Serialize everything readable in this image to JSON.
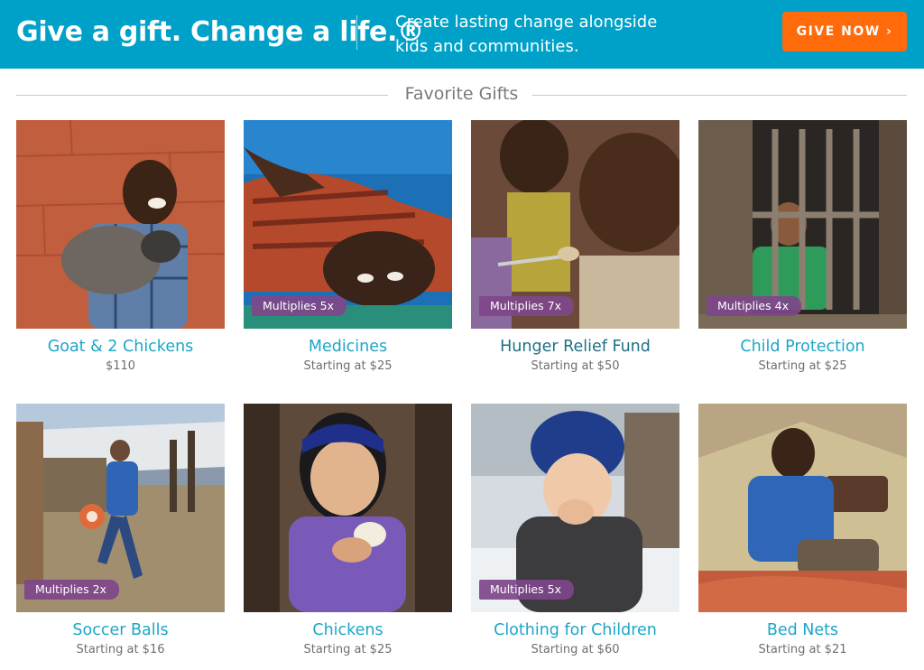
{
  "banner": {
    "title": "Give a gift. Change a life.®",
    "tagline": "Create lasting change alongside kids and communities.",
    "cta_label": "GIVE NOW ›",
    "background": "#00a1c8",
    "cta_color": "#ff6b0a"
  },
  "section": {
    "heading": "Favorite Gifts"
  },
  "gifts": [
    {
      "title": "Goat & 2 Chickens",
      "price": "$110",
      "badge": "",
      "photo": "boy-holding-goat"
    },
    {
      "title": "Medicines",
      "price": "Starting at $25",
      "badge": "Multiplies 5x",
      "photo": "child-resting-on-blanket"
    },
    {
      "title": "Hunger Relief Fund",
      "price": "Starting at $50",
      "badge": "Multiplies 7x",
      "photo": "toddler-eating"
    },
    {
      "title": "Child Protection",
      "price": "Starting at $25",
      "badge": "Multiplies 4x",
      "photo": "boy-behind-bars"
    },
    {
      "title": "Soccer Balls",
      "price": "Starting at $16",
      "badge": "Multiplies 2x",
      "photo": "boy-kicking-ball"
    },
    {
      "title": "Chickens",
      "price": "Starting at $25",
      "badge": "",
      "photo": "girl-holding-chick"
    },
    {
      "title": "Clothing for Children",
      "price": "Starting at $60",
      "badge": "Multiplies 5x",
      "photo": "child-in-winter-hat"
    },
    {
      "title": "Bed Nets",
      "price": "Starting at $21",
      "badge": "",
      "photo": "boy-under-net"
    }
  ]
}
